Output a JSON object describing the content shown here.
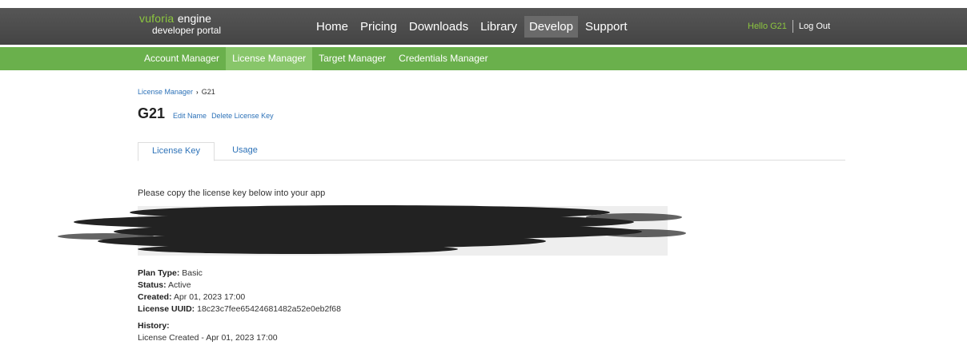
{
  "header": {
    "logo_brand": "vuforia",
    "logo_engine": "engine",
    "logo_sub": "developer portal",
    "nav": [
      {
        "label": "Home",
        "active": false
      },
      {
        "label": "Pricing",
        "active": false
      },
      {
        "label": "Downloads",
        "active": false
      },
      {
        "label": "Library",
        "active": false
      },
      {
        "label": "Develop",
        "active": true
      },
      {
        "label": "Support",
        "active": false
      }
    ],
    "hello": "Hello G21",
    "logout": "Log Out"
  },
  "subnav": [
    {
      "label": "Account Manager",
      "active": false
    },
    {
      "label": "License Manager",
      "active": true
    },
    {
      "label": "Target Manager",
      "active": false
    },
    {
      "label": "Credentials Manager",
      "active": false
    }
  ],
  "breadcrumb": {
    "parent": "License Manager",
    "current": "G21"
  },
  "title": {
    "name": "G21",
    "edit_name": "Edit Name",
    "delete_key": "Delete License Key"
  },
  "tabs": [
    {
      "label": "License Key",
      "active": true
    },
    {
      "label": "Usage",
      "active": false
    }
  ],
  "instruction": "Please copy the license key below into your app",
  "details": {
    "plan_type_label": "Plan Type:",
    "plan_type": "Basic",
    "status_label": "Status:",
    "status": "Active",
    "created_label": "Created:",
    "created": "Apr 01, 2023 17:00",
    "uuid_label": "License UUID:",
    "uuid": "18c23c7fee65424681482a52e0eb2f68",
    "history_label": "History:",
    "history_entry": "License Created - Apr 01, 2023 17:00"
  },
  "colors": {
    "topbar": "#4a4a4a",
    "green": "#6ab04c",
    "link": "#2d72b8",
    "brand_green": "#8cc63f"
  }
}
